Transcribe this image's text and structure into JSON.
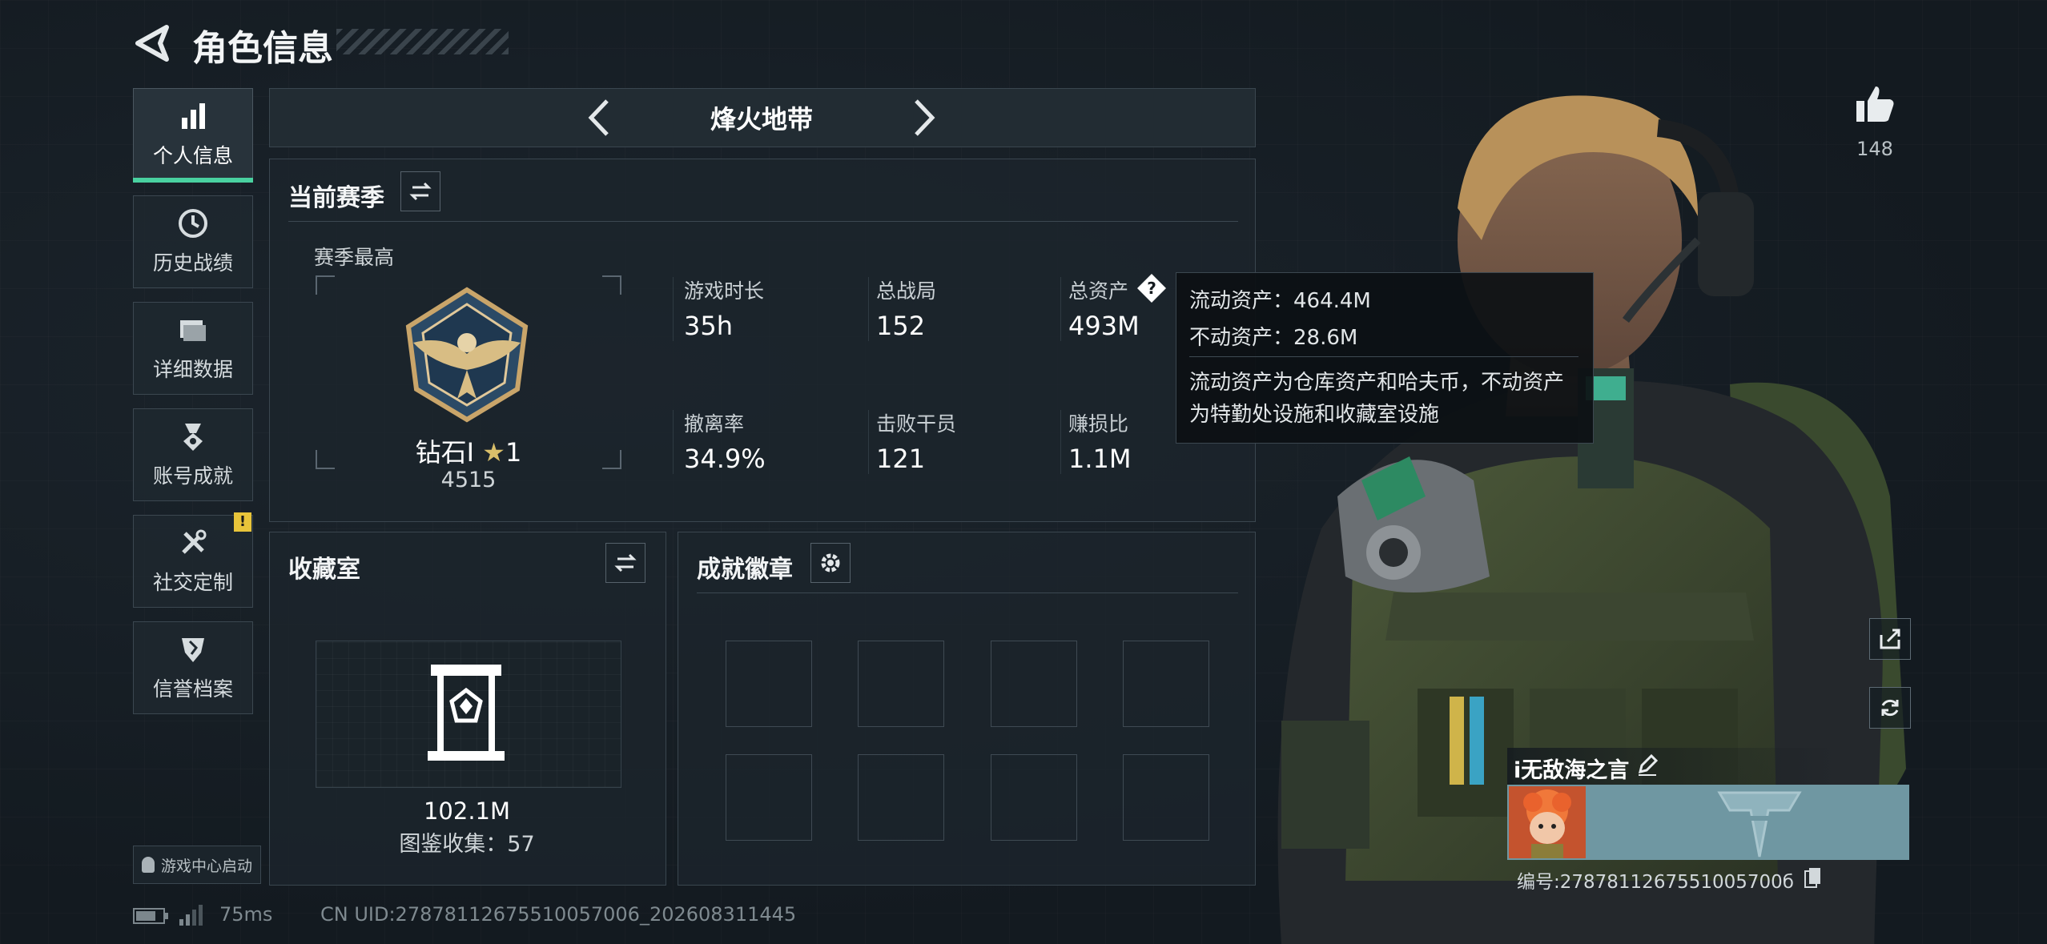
{
  "header": {
    "title": "角色信息"
  },
  "sidebar": {
    "items": [
      {
        "label": "个人信息",
        "icon": "bar-chart-icon",
        "active": true
      },
      {
        "label": "历史战绩",
        "icon": "clock-icon"
      },
      {
        "label": "详细数据",
        "icon": "folder-icon"
      },
      {
        "label": "账号成就",
        "icon": "medal-icon"
      },
      {
        "label": "社交定制",
        "icon": "tools-icon",
        "alert": "!"
      },
      {
        "label": "信誉档案",
        "icon": "shield-icon"
      }
    ],
    "launcher_label": "游戏中心启动"
  },
  "mode_selector": {
    "label": "烽火地带"
  },
  "season": {
    "title": "当前赛季",
    "best_label": "赛季最高",
    "rank_name": "钻石I",
    "rank_stars": "1",
    "rank_score": "4515",
    "stats": [
      {
        "label": "游戏时长",
        "value": "35h"
      },
      {
        "label": "总战局",
        "value": "152"
      },
      {
        "label": "总资产",
        "value": "493M"
      },
      {
        "label": "撤离率",
        "value": "34.9%"
      },
      {
        "label": "击败干员",
        "value": "121"
      },
      {
        "label": "赚损比",
        "value": "1.1M"
      }
    ]
  },
  "tooltip": {
    "liquid": "流动资产：464.4M",
    "fixed": "不动资产：28.6M",
    "desc1": "流动资产为仓库资产和哈夫币，不动资产",
    "desc2": "为特勤处设施和收藏室设施"
  },
  "collection": {
    "title": "收藏室",
    "value": "102.1M",
    "count_label": "图鉴收集：57"
  },
  "badges": {
    "title": "成就徽章",
    "slots": 8
  },
  "likes": {
    "count": "148"
  },
  "player": {
    "name": "i无敌海之言",
    "id_label": "编号:2787811267551005700б"
  },
  "status": {
    "ping": "75ms",
    "uid": "CN UID:27878112675510057006_202608311445"
  },
  "colors": {
    "accent": "#49d1a0",
    "alert": "#e8c43a",
    "panel": "#1c252c"
  }
}
